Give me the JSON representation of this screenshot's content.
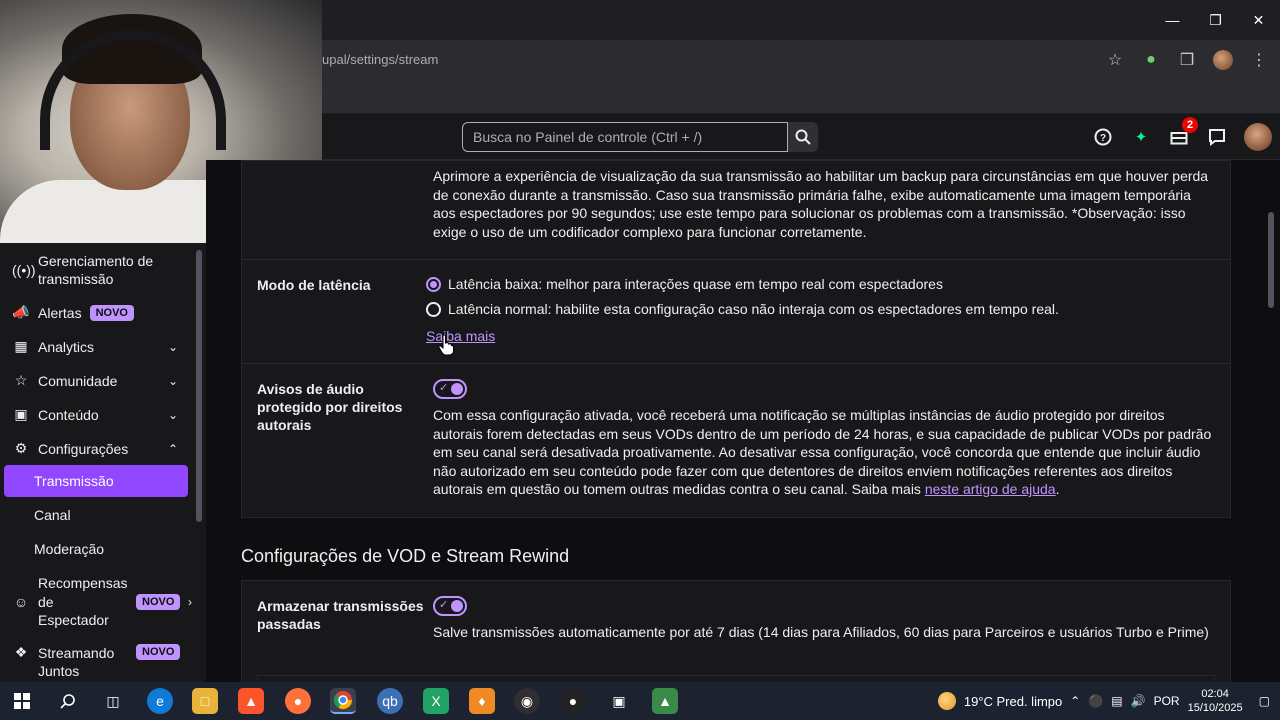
{
  "browser": {
    "url": "upal/settings/stream"
  },
  "topnav": {
    "search_placeholder": "Busca no Painel de controle (Ctrl + /)",
    "notification_count": "2"
  },
  "sidebar": {
    "items": [
      {
        "label": "Gerenciamento de transmissão",
        "icon": "broadcast-icon"
      },
      {
        "label": "Alertas",
        "icon": "megaphone-icon",
        "badge": "NOVO"
      },
      {
        "label": "Analytics",
        "icon": "analytics-icon"
      },
      {
        "label": "Comunidade",
        "icon": "community-icon"
      },
      {
        "label": "Conteúdo",
        "icon": "content-icon"
      },
      {
        "label": "Configurações",
        "icon": "gear-icon"
      }
    ],
    "sub_items": [
      "Transmissão",
      "Canal",
      "Moderação"
    ],
    "rewards": {
      "label": "Recompensas de Espectador",
      "badge": "NOVO"
    },
    "together": {
      "label": "Streamando Juntos",
      "badge": "NOVO"
    }
  },
  "main": {
    "backup_text": "Aprimore a experiência de visualização da sua transmissão ao habilitar um backup para circunstâncias em que houver perda de conexão durante a transmissão. Caso sua transmissão primária falhe, exibe automaticamente uma imagem temporária aos espectadores por 90 segundos; use este tempo para solucionar os problemas com a transmissão. *Observação: isso exige o uso de um codificador complexo para funcionar corretamente.",
    "latency": {
      "label": "Modo de latência",
      "option_low": "Latência baixa: melhor para interações quase em tempo real com espectadores",
      "option_normal": "Latência normal: habilite esta configuração caso não interaja com os espectadores em tempo real.",
      "selected": "low",
      "learn_more": "Saiba mais"
    },
    "audio_warnings": {
      "label": "Avisos de áudio protegido por direitos autorais",
      "enabled": true,
      "text": "Com essa configuração ativada, você receberá uma notificação se múltiplas instâncias de áudio protegido por direitos autorais forem detectadas em seus VODs dentro de um período de 24 horas, e sua capacidade de publicar VODs por padrão em seu canal será desativada proativamente. Ao desativar essa configuração, você concorda que entende que incluir áudio não autorizado em seu conteúdo pode fazer com que detentores de direitos enviem notificações referentes aos direitos autorais em questão ou tomem outras medidas contra o seu canal. Saiba mais ",
      "help_link": "neste artigo de ajuda",
      "trailing": "."
    },
    "vod_section_title": "Configurações de VOD e Stream Rewind",
    "store_past": {
      "label": "Armazenar transmissões passadas",
      "enabled": true,
      "text": "Salve transmissões automaticamente por até 7 dias (14 dias para Afiliados, 60 dias para Parceiros e usuários Turbo e Prime)"
    }
  },
  "taskbar": {
    "weather": "19°C  Pred. limpo",
    "language": "POR",
    "time": "02:04",
    "date": "15/10/2025"
  }
}
